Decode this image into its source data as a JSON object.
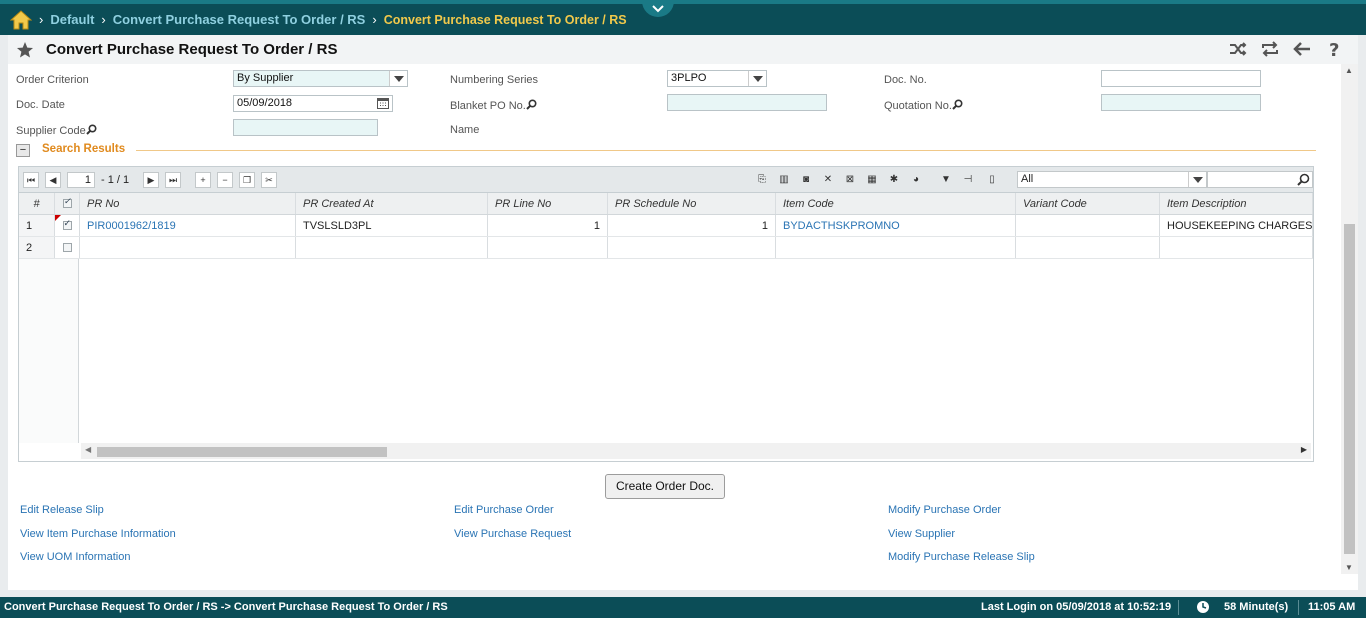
{
  "breadcrumb": {
    "items": [
      "Default",
      "Convert Purchase Request To Order / RS",
      "Convert Purchase Request To Order / RS"
    ]
  },
  "page": {
    "title": "Convert Purchase Request To Order / RS"
  },
  "form": {
    "order_criterion": {
      "label": "Order Criterion",
      "value": "By Supplier"
    },
    "numbering_series": {
      "label": "Numbering Series",
      "value": "3PLPO"
    },
    "doc_no": {
      "label": "Doc. No.",
      "value": ""
    },
    "doc_date": {
      "label": "Doc. Date",
      "value": "05/09/2018"
    },
    "blanket_po": {
      "label": "Blanket PO No.",
      "value": ""
    },
    "quotation_no": {
      "label": "Quotation No.",
      "value": ""
    },
    "supplier_code": {
      "label": "Supplier Code",
      "value": ""
    },
    "name": {
      "label": "Name",
      "value": ""
    }
  },
  "section": {
    "title": "Search Results"
  },
  "grid": {
    "pager": {
      "page": "1",
      "of": "- 1 / 1"
    },
    "filter": {
      "value": "All"
    },
    "columns": [
      "#",
      "PR No",
      "PR Created At",
      "PR Line No",
      "PR Schedule No",
      "Item Code",
      "Variant Code",
      "Item Description"
    ],
    "rows": [
      {
        "num": "1",
        "checked": true,
        "pr_no": "PIR0001962/1819",
        "pr_created_at": "TVSLSLD3PL",
        "pr_line_no": "1",
        "pr_schedule_no": "1",
        "item_code": "BYDACTHSKPROMNO",
        "variant_code": "",
        "item_description": "HOUSEKEEPING CHARGES"
      },
      {
        "num": "2",
        "checked": false,
        "pr_no": "",
        "pr_created_at": "",
        "pr_line_no": "",
        "pr_schedule_no": "",
        "item_code": "",
        "variant_code": "",
        "item_description": ""
      }
    ]
  },
  "actions": {
    "create_button": "Create Order Doc.",
    "links": {
      "edit_release_slip": "Edit Release Slip",
      "edit_purchase_order": "Edit Purchase Order",
      "modify_purchase_order": "Modify Purchase Order",
      "view_item_purchase_info": "View Item Purchase Information",
      "view_purchase_request": "View Purchase Request",
      "view_supplier": "View Supplier",
      "view_uom_info": "View UOM Information",
      "modify_purchase_release_slip": "Modify Purchase Release Slip"
    }
  },
  "status": {
    "path": "Convert Purchase Request To Order / RS -> Convert Purchase Request To Order / RS",
    "last_login": "Last Login on 05/09/2018 at 10:52:19",
    "session": "58 Minute(s)",
    "time": "11:05 AM"
  },
  "colors": {
    "header_bg": "#0b4d57",
    "accent": "#f1c94b",
    "link": "#2a74b4",
    "section_title": "#e08a1e"
  }
}
